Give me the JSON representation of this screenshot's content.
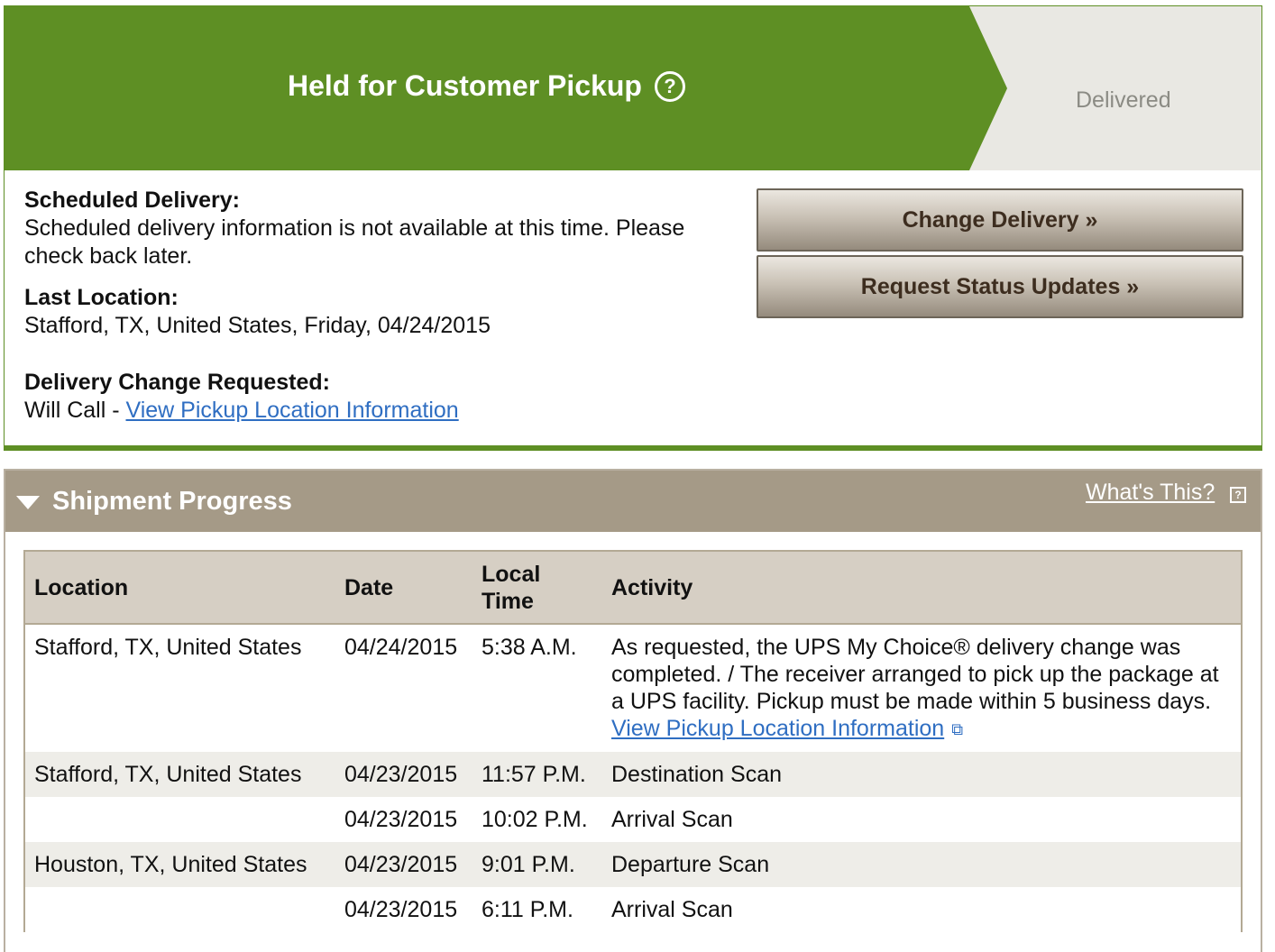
{
  "status": {
    "title": "Held for Customer Pickup",
    "help_icon": "?",
    "next_step": "Delivered",
    "banner_color": "#5e8f24"
  },
  "details": {
    "scheduled_label": "Scheduled Delivery:",
    "scheduled_text": "Scheduled delivery information is not available at this time. Please check back later.",
    "last_location_label": "Last Location:",
    "last_location_text": "Stafford, TX, United States, Friday, 04/24/2015",
    "change_requested_label": "Delivery Change Requested:",
    "change_requested_prefix": "Will Call - ",
    "pickup_link": "View Pickup Location Information"
  },
  "actions": {
    "change_delivery": "Change Delivery »",
    "request_updates": "Request Status Updates »"
  },
  "progress": {
    "title": "Shipment Progress",
    "whats_this": "What's This?",
    "columns": [
      "Location",
      "Date",
      "Local Time",
      "Activity"
    ],
    "rows": [
      {
        "location": "Stafford, TX, United States",
        "date": "04/24/2015",
        "time": "5:38 A.M.",
        "activity": "As requested, the UPS My Choice® delivery change was completed. / The receiver arranged to pick up the package at a UPS facility. Pickup must be made within 5 business days.",
        "link": "View Pickup Location Information"
      },
      {
        "location": "Stafford, TX, United States",
        "date": "04/23/2015",
        "time": "11:57 P.M.",
        "activity": "Destination Scan"
      },
      {
        "location": "",
        "date": "04/23/2015",
        "time": "10:02 P.M.",
        "activity": "Arrival Scan"
      },
      {
        "location": "Houston, TX, United States",
        "date": "04/23/2015",
        "time": "9:01 P.M.",
        "activity": "Departure Scan"
      },
      {
        "location": "",
        "date": "04/23/2015",
        "time": "6:11 P.M.",
        "activity": "Arrival Scan"
      }
    ]
  }
}
